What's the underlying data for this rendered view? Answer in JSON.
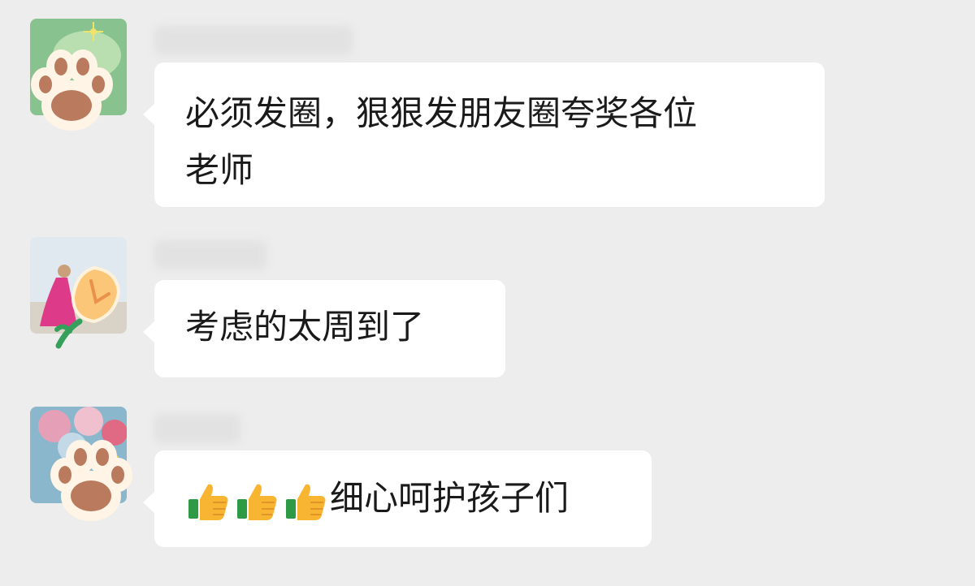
{
  "chat": {
    "messages": [
      {
        "avatar_icon": "cat-paw-sticker-icon",
        "lines": [
          "必须发圈，狠狠发朋友圈夸奖各位",
          "老师"
        ]
      },
      {
        "avatar_icon": "tulip-sticker-icon",
        "lines": [
          "考虑的太周到了"
        ]
      },
      {
        "avatar_icon": "cat-paw-sticker-icon",
        "emoji_icons": [
          "thumbs-up-icon",
          "thumbs-up-icon",
          "thumbs-up-icon"
        ],
        "text": "细心呵护孩子们"
      }
    ]
  },
  "colors": {
    "background": "#ededed",
    "bubble": "#ffffff",
    "text": "#1a1a1a"
  }
}
